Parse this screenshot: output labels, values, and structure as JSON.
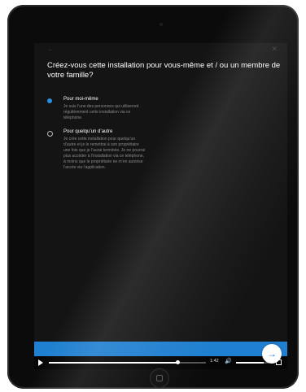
{
  "screen": {
    "question": "Créez-vous cette installation pour vous-même et / ou un membre de votre famille?",
    "back_icon": "←",
    "close_icon": "✕",
    "options": [
      {
        "title": "Pour moi-même",
        "description": "Je suis l’une des personnes qui utiliseront régulièrement cette installation via ce téléphone.",
        "selected": true
      },
      {
        "title": "Pour quelqu’un d’autre",
        "description": "Je crée cette installation pour quelqu’un d’autre et je le remettrai à son propriétaire une fois que je l’aurai terminée. Je ne pourrai plus accéder à l’installation via ce téléphone, à moins que le propriétaire ne m’en autorise l’accès via l’application.",
        "selected": false
      }
    ],
    "next_icon": "→"
  },
  "player": {
    "time": "1:42",
    "progress": 0.82,
    "volume": 0.85,
    "volume_icon": "🔊"
  },
  "colors": {
    "accent": "#1f7fd0",
    "radio_selected": "#2b8fe0",
    "screen_bg": "#141414"
  }
}
